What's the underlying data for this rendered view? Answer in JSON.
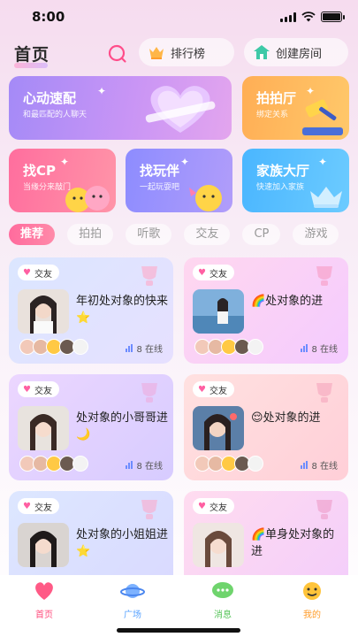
{
  "status_bar": {
    "time": "8:00"
  },
  "header": {
    "title": "首页",
    "rank_label": "排行榜",
    "create_label": "创建房间"
  },
  "features": {
    "match": {
      "title": "心动速配",
      "subtitle": "和最匹配的人聊天"
    },
    "paipai": {
      "title": "拍拍厅",
      "subtitle": "绑定关系"
    },
    "cp": {
      "title": "找CP",
      "subtitle": "当缘分来敲门"
    },
    "partner": {
      "title": "找玩伴",
      "subtitle": "一起玩耍吧"
    },
    "family": {
      "title": "家族大厅",
      "subtitle": "快速加入家族"
    }
  },
  "tabs": [
    "推荐",
    "拍拍",
    "听歌",
    "交友",
    "CP",
    "游戏"
  ],
  "rooms": [
    {
      "tag": "交友",
      "title": "年初处对象的快来⭐",
      "online": "8 在线"
    },
    {
      "tag": "交友",
      "title": "🌈处对象的进",
      "online": "8 在线"
    },
    {
      "tag": "交友",
      "title": "处对象的小哥哥进🌙",
      "online": "8 在线"
    },
    {
      "tag": "交友",
      "title": "😌处对象的进",
      "online": "8 在线"
    },
    {
      "tag": "交友",
      "title": "处对象的小姐姐进⭐",
      "online": ""
    },
    {
      "tag": "交友",
      "title": "🌈单身处对象的进",
      "online": ""
    }
  ],
  "tabbar": {
    "home": "首页",
    "square": "广场",
    "messages": "消息",
    "mine": "我的"
  },
  "colors": {
    "accent_pink": "#ff6b9d",
    "match_card": "#b28ff5",
    "paipai_card": "#ffb95c",
    "cp_card": "#ff7fa3",
    "partner_card": "#9e95fc",
    "family_card": "#58bfff"
  }
}
